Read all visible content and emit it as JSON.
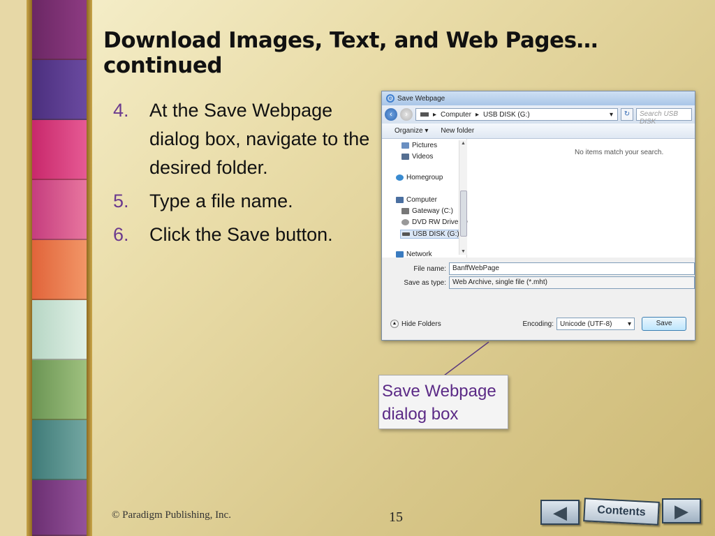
{
  "slide": {
    "title": "Download Images, Text, and Web Pages…continued",
    "steps": [
      {
        "num": "4.",
        "text": "At the Save Webpage dialog box, navigate to the desired folder."
      },
      {
        "num": "5.",
        "text": "Type a file name."
      },
      {
        "num": "6.",
        "text": "Click the Save button."
      }
    ],
    "callout": "Save Webpage dialog box",
    "footer": {
      "copyright": "© Paradigm Publishing, Inc.",
      "page": "15"
    },
    "nav": {
      "prev_glyph": "◀",
      "next_glyph": "▶",
      "contents_label": "Contents"
    }
  },
  "dialog": {
    "title": "Save Webpage",
    "address": {
      "path": [
        "Computer",
        "USB DISK (G:)"
      ],
      "search_placeholder": "Search USB DISK"
    },
    "toolbar": {
      "organize": "Organize ▾",
      "new_folder": "New folder"
    },
    "nav_items": [
      {
        "label": "Pictures",
        "icon": "pictures-icon",
        "color": "#6a8fc1"
      },
      {
        "label": "Videos",
        "icon": "videos-icon",
        "color": "#556f92"
      },
      {
        "label": "Homegroup",
        "icon": "homegroup-icon",
        "color": "#3a8bd0"
      },
      {
        "label": "Computer",
        "icon": "computer-icon",
        "color": "#4a6fa0"
      },
      {
        "label": "Gateway (C:)",
        "icon": "drive-icon",
        "color": "#777"
      },
      {
        "label": "DVD RW Drive (D",
        "icon": "dvd-icon",
        "color": "#999"
      },
      {
        "label": "USB DISK (G:)",
        "icon": "usb-drive-icon",
        "color": "#555"
      },
      {
        "label": "Network",
        "icon": "network-icon",
        "color": "#3a7bc0"
      }
    ],
    "empty_message": "No items match your search.",
    "file_name_label": "File name:",
    "file_name": "BanffWebPage",
    "save_type_label": "Save as type:",
    "save_type": "Web Archive, single file (*.mht)",
    "hide_folders": "Hide Folders",
    "encoding_label": "Encoding:",
    "encoding": "Unicode (UTF-8)",
    "save_button": "Save"
  },
  "colors": {
    "accent": "#6b3a8e",
    "bands": [
      "#7a2d6e",
      "#5b3a8e",
      "#d63b7b",
      "#d34a8a",
      "#e8744a",
      "#c8e3d4",
      "#7ea565",
      "#4f8a86",
      "#7b3d7f"
    ]
  }
}
